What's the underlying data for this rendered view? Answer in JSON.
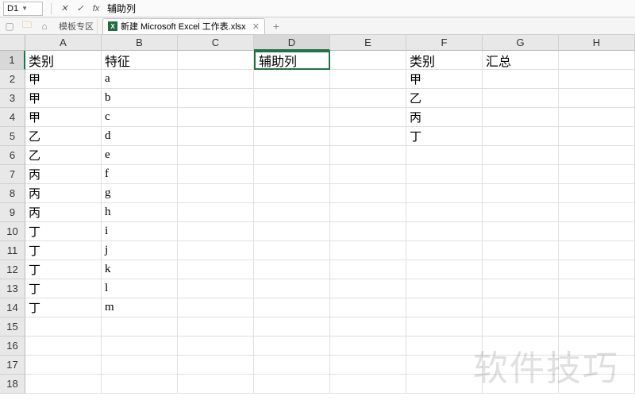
{
  "namebox": {
    "cell_ref": "D1"
  },
  "formula_bar": {
    "value": "辅助列"
  },
  "tabs": {
    "template_zone": "模板专区",
    "file": {
      "name": "新建 Microsoft Excel 工作表.xlsx"
    }
  },
  "columns": [
    "A",
    "B",
    "C",
    "D",
    "E",
    "F",
    "G",
    "H"
  ],
  "rows": [
    1,
    2,
    3,
    4,
    5,
    6,
    7,
    8,
    9,
    10,
    11,
    12,
    13,
    14,
    15,
    16,
    17,
    18
  ],
  "selected": {
    "row": 1,
    "col": "D"
  },
  "cells": {
    "r1": {
      "A": "类别",
      "B": "特征",
      "C": "",
      "D": "辅助列",
      "E": "",
      "F": "类别",
      "G": "汇总",
      "H": ""
    },
    "r2": {
      "A": "甲",
      "B": "a",
      "C": "",
      "D": "",
      "E": "",
      "F": "甲",
      "G": "",
      "H": ""
    },
    "r3": {
      "A": "甲",
      "B": "b",
      "C": "",
      "D": "",
      "E": "",
      "F": "乙",
      "G": "",
      "H": ""
    },
    "r4": {
      "A": "甲",
      "B": "c",
      "C": "",
      "D": "",
      "E": "",
      "F": "丙",
      "G": "",
      "H": ""
    },
    "r5": {
      "A": "乙",
      "B": "d",
      "C": "",
      "D": "",
      "E": "",
      "F": "丁",
      "G": "",
      "H": ""
    },
    "r6": {
      "A": "乙",
      "B": "e",
      "C": "",
      "D": "",
      "E": "",
      "F": "",
      "G": "",
      "H": ""
    },
    "r7": {
      "A": "丙",
      "B": "f",
      "C": "",
      "D": "",
      "E": "",
      "F": "",
      "G": "",
      "H": ""
    },
    "r8": {
      "A": "丙",
      "B": "g",
      "C": "",
      "D": "",
      "E": "",
      "F": "",
      "G": "",
      "H": ""
    },
    "r9": {
      "A": "丙",
      "B": "h",
      "C": "",
      "D": "",
      "E": "",
      "F": "",
      "G": "",
      "H": ""
    },
    "r10": {
      "A": "丁",
      "B": "i",
      "C": "",
      "D": "",
      "E": "",
      "F": "",
      "G": "",
      "H": ""
    },
    "r11": {
      "A": "丁",
      "B": "j",
      "C": "",
      "D": "",
      "E": "",
      "F": "",
      "G": "",
      "H": ""
    },
    "r12": {
      "A": "丁",
      "B": "k",
      "C": "",
      "D": "",
      "E": "",
      "F": "",
      "G": "",
      "H": ""
    },
    "r13": {
      "A": "丁",
      "B": "l",
      "C": "",
      "D": "",
      "E": "",
      "F": "",
      "G": "",
      "H": ""
    },
    "r14": {
      "A": "丁",
      "B": "m",
      "C": "",
      "D": "",
      "E": "",
      "F": "",
      "G": "",
      "H": ""
    },
    "r15": {
      "A": "",
      "B": "",
      "C": "",
      "D": "",
      "E": "",
      "F": "",
      "G": "",
      "H": ""
    },
    "r16": {
      "A": "",
      "B": "",
      "C": "",
      "D": "",
      "E": "",
      "F": "",
      "G": "",
      "H": ""
    },
    "r17": {
      "A": "",
      "B": "",
      "C": "",
      "D": "",
      "E": "",
      "F": "",
      "G": "",
      "H": ""
    },
    "r18": {
      "A": "",
      "B": "",
      "C": "",
      "D": "",
      "E": "",
      "F": "",
      "G": "",
      "H": ""
    }
  },
  "watermark": "软件技巧"
}
